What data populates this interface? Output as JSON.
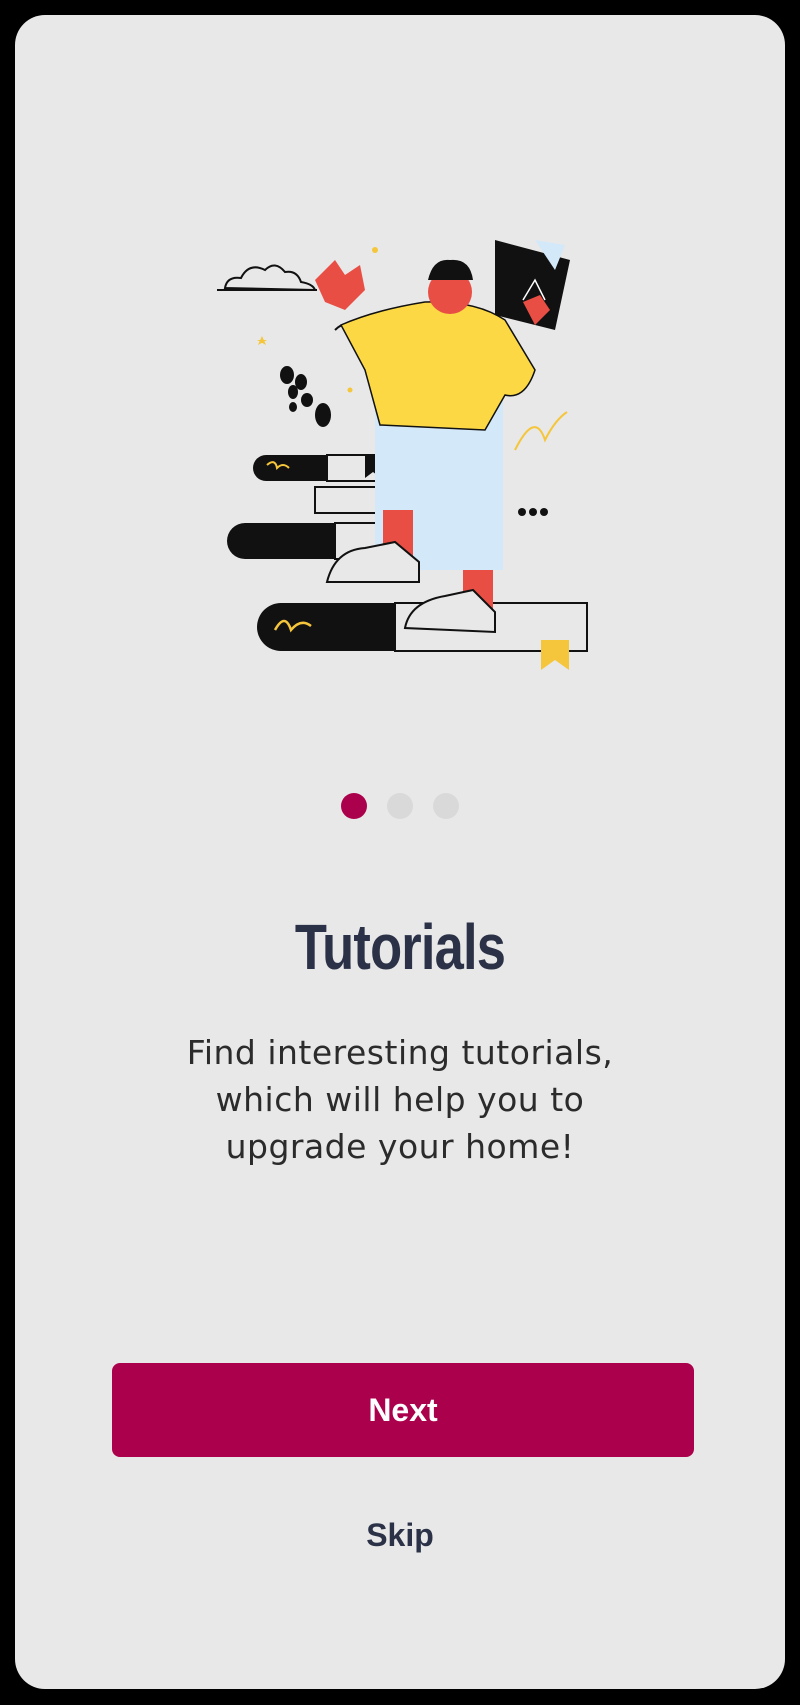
{
  "onboarding": {
    "title": "Tutorials",
    "description": "Find interesting tutorials, which will help you to upgrade your home!",
    "pagination": {
      "total": 3,
      "active_index": 0
    },
    "next_label": "Next",
    "skip_label": "Skip",
    "illustration": "person-on-books-reading-illustration"
  },
  "colors": {
    "background": "#e8e8e8",
    "accent": "#ab004b",
    "title": "#2b3247",
    "dot_inactive": "#d9d9d9"
  }
}
